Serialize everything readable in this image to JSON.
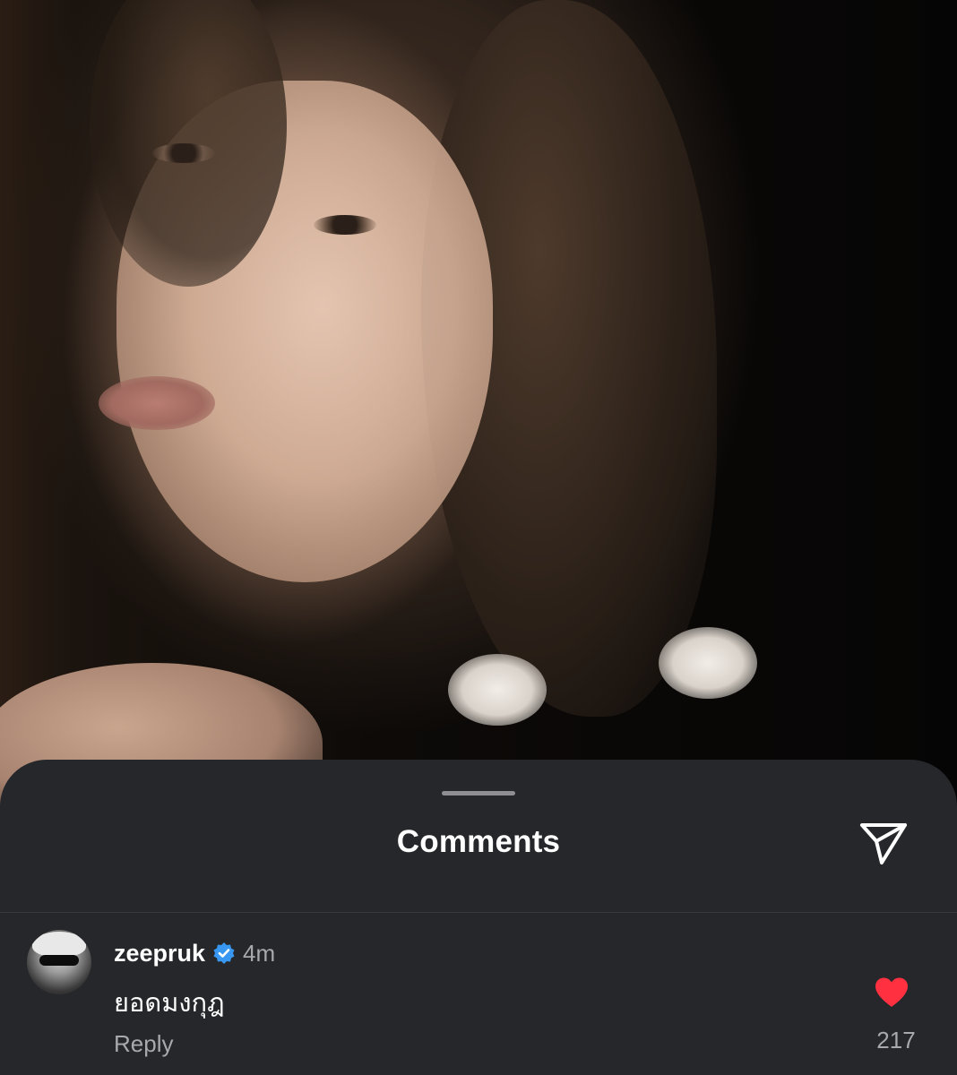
{
  "sheet": {
    "title": "Comments",
    "share_icon": "paper-plane-icon"
  },
  "comment": {
    "username": "zeepruk",
    "verified_icon": "verified-badge-icon",
    "verified_color": "#3897f0",
    "timestamp": "4m",
    "text": "ยอดมงกุฎ",
    "reply_label": "Reply",
    "like_icon": "heart-icon",
    "like_color": "#ff3040",
    "liked": true,
    "like_count": "217"
  }
}
